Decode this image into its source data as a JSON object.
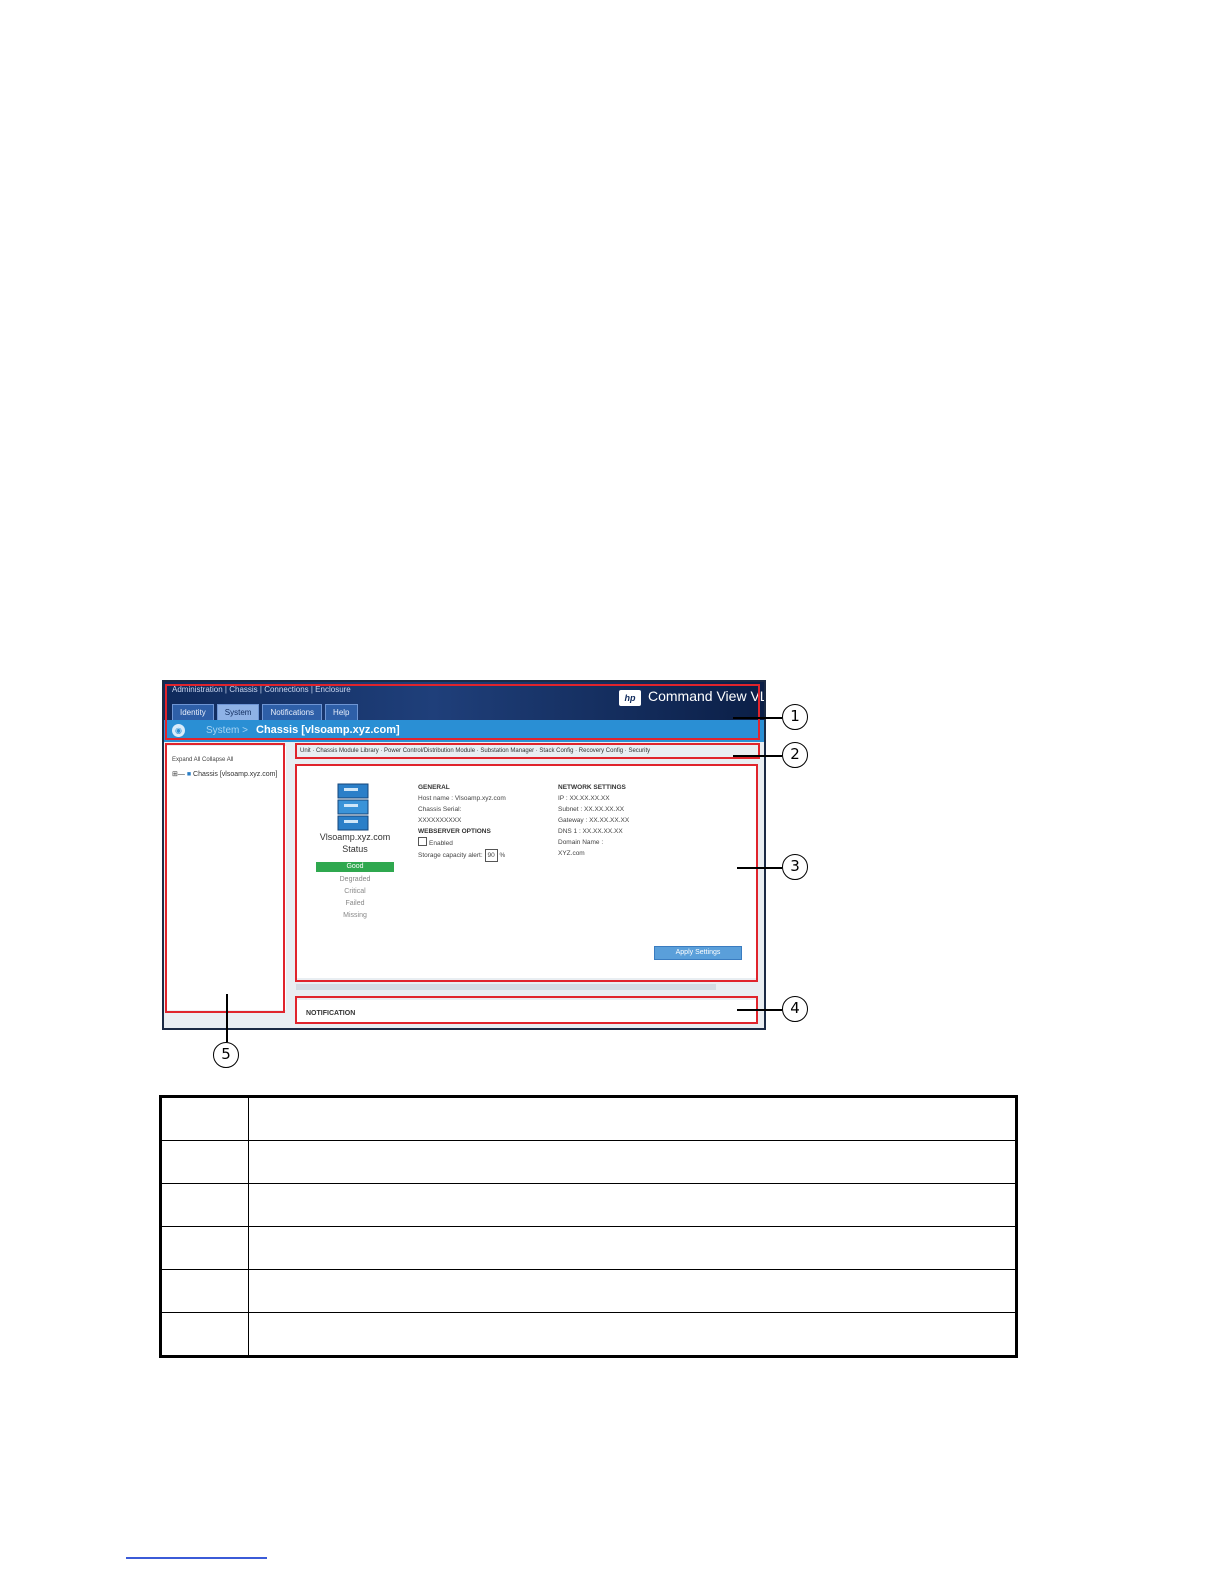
{
  "screenshot": {
    "header": {
      "links": "Administration | Chassis | Connections | Enclosure",
      "tabs": [
        "Identity",
        "System",
        "Notifications",
        "Help"
      ],
      "active_tab": "System",
      "logo_text": "hp",
      "app_name": "Command View VL"
    },
    "breadcrumb": {
      "section": "System >",
      "title": "Chassis [vlsoamp.xyz.com]"
    },
    "left_panel": {
      "buttons": "Expand All   Collapse All",
      "tree_item": "Chassis [vlsoamp.xyz.com]"
    },
    "nav_links": "Unit  ·  Chassis Module Library  ·  Power Control/Distribution Module  ·  Substation Manager  ·  Stack Config  ·  Recovery Config  ·  Security",
    "status": {
      "name": "Vlsoamp.xyz.com",
      "label": "Status",
      "good": "Good",
      "others": [
        "Degraded",
        "Critical",
        "Failed",
        "Missing"
      ]
    },
    "general": {
      "heading": "GENERAL",
      "hostname": "Host name : Vlsoamp.xyz.com",
      "serial_label": "Chassis Serial:",
      "serial_value": "XXXXXXXXXX",
      "web_heading": "WEBSERVER OPTIONS",
      "enabled": "Enabled",
      "capacity": "Storage capacity alert:",
      "capacity_value": "90",
      "capacity_unit": "%"
    },
    "network": {
      "heading": "NETWORK SETTINGS",
      "ip": "IP : XX.XX.XX.XX",
      "subnet": "Subnet : XX.XX.XX.XX",
      "gateway": "Gateway : XX.XX.XX.XX",
      "dns": "DNS 1 : XX.XX.XX.XX",
      "domain": "Domain Name :",
      "domain_value": "XYZ.com"
    },
    "apply_label": "Apply Settings",
    "notification_label": "NOTIFICATION"
  },
  "callouts": [
    "1",
    "2",
    "3",
    "4",
    "5"
  ],
  "legend_rows": [
    "",
    "",
    "",
    "",
    "",
    ""
  ]
}
